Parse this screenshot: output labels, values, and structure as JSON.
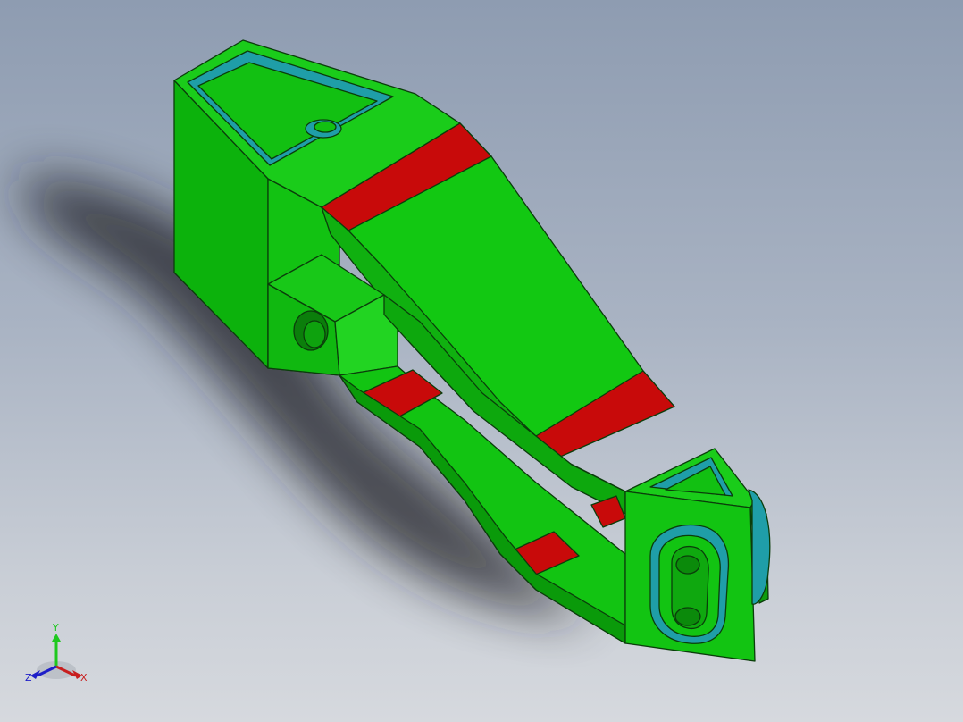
{
  "viewport": {
    "background_top": "#8e9cb1",
    "background_bottom": "#d6d9de"
  },
  "model": {
    "face_color": "#12c812",
    "face_color_light": "#1fd01f",
    "face_color_dark": "#0aa40a",
    "edge_color": "#0b3d0b",
    "marked_face_color": "#c80a0a",
    "hidden_face_color": "#1f9ea8"
  },
  "triad": {
    "x_label": "X",
    "y_label": "Y",
    "z_label": "Z",
    "x_color": "#c81e1e",
    "y_color": "#1ec81e",
    "z_color": "#1e1ec8"
  }
}
